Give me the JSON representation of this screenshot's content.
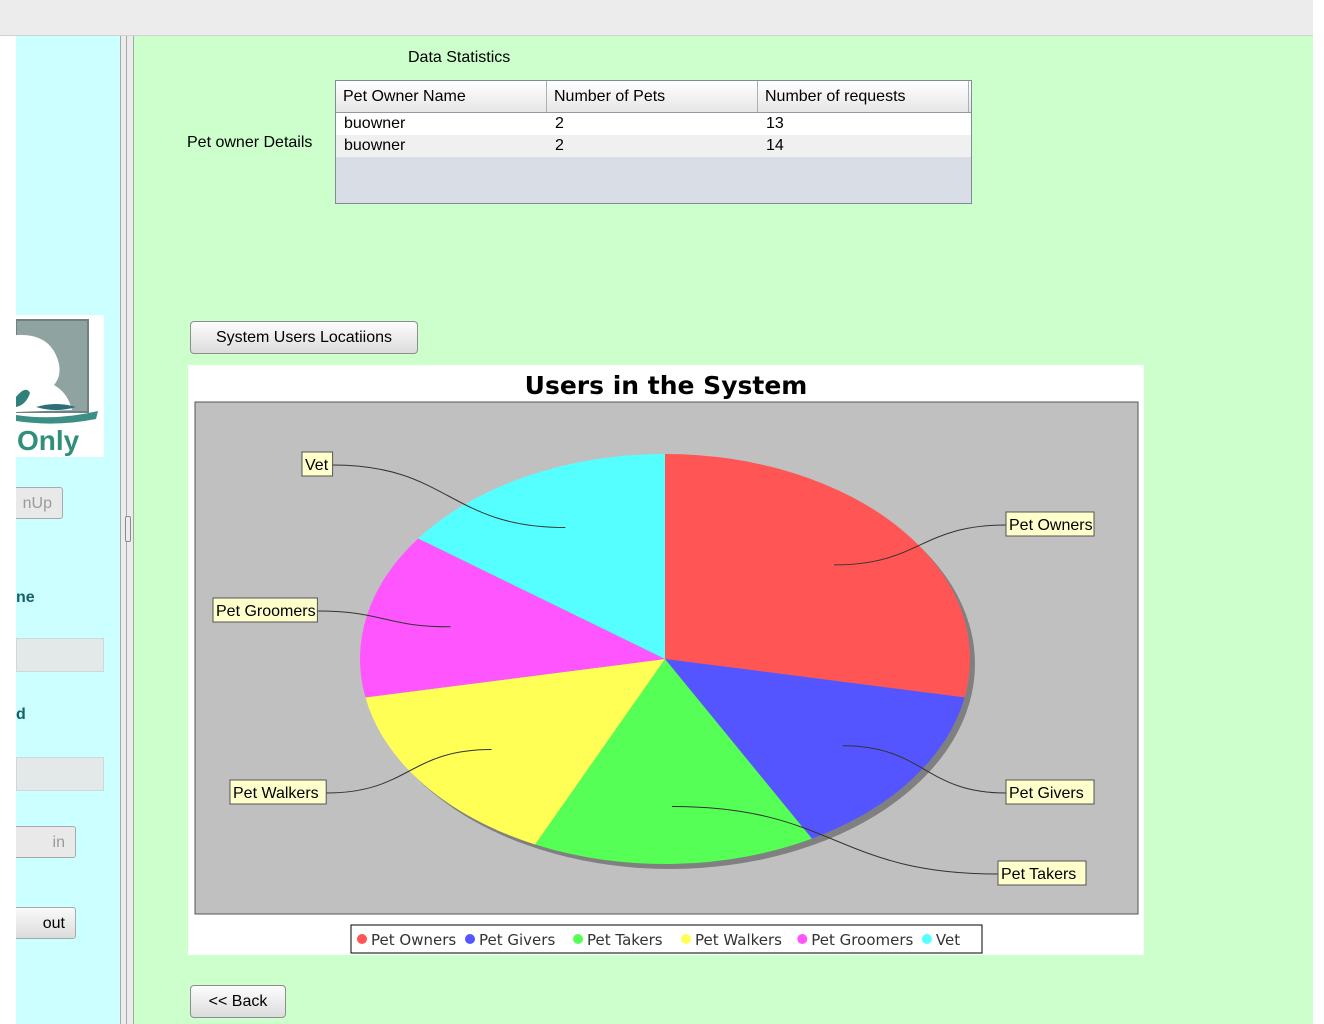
{
  "sidebar": {
    "logo_text": "Only",
    "signup_label": "nUp",
    "name_label": "ne",
    "password_label": "d",
    "login_label": "in",
    "logout_label": "out"
  },
  "main": {
    "section_title": "Data Statistics",
    "details_label": "Pet owner Details",
    "table": {
      "columns": [
        "Pet Owner Name",
        "Number of Pets",
        "Number of requests"
      ],
      "rows": [
        [
          "buowner",
          "2",
          "13"
        ],
        [
          "buowner",
          "2",
          "14"
        ]
      ]
    },
    "locations_button": "System Users Locatiions",
    "back_button": "<< Back"
  },
  "chart_data": {
    "type": "pie",
    "title": "Users in the System",
    "categories": [
      "Pet Owners",
      "Pet Givers",
      "Pet Takers",
      "Pet Walkers",
      "Pet Groomers",
      "Vet"
    ],
    "values": [
      28,
      14,
      15,
      15,
      13,
      15
    ],
    "colors": [
      "#ff5555",
      "#5555ff",
      "#55ff55",
      "#ffff55",
      "#ff55ff",
      "#55ffff"
    ],
    "legend_position": "bottom",
    "plot_background": "#c0c0c0"
  }
}
